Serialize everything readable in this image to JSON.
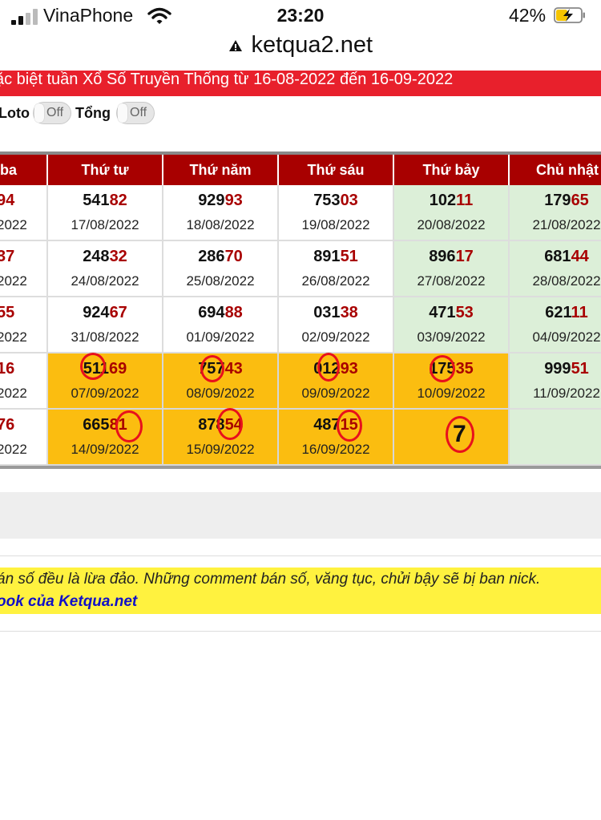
{
  "status_bar": {
    "carrier": "VinaPhone",
    "time": "23:20",
    "battery_percent": "42%",
    "url": "ketqua2.net"
  },
  "banner": {
    "text": "ặc biệt tuần Xổ Số Truyền Thống từ 16-08-2022 đến 16-09-2022"
  },
  "toggles": {
    "loto_label": "Loto",
    "loto_state": "Off",
    "tong_label": "Tổng",
    "tong_state": "Off"
  },
  "table": {
    "headers": [
      "ba",
      "Thứ tư",
      "Thứ năm",
      "Thứ sáu",
      "Thứ bảy",
      "Chủ nhật"
    ],
    "rows": [
      [
        {
          "head": "",
          "tail": "94",
          "date": "2022"
        },
        {
          "head": "541",
          "tail": "82",
          "date": "17/08/2022"
        },
        {
          "head": "929",
          "tail": "93",
          "date": "18/08/2022"
        },
        {
          "head": "753",
          "tail": "03",
          "date": "19/08/2022"
        },
        {
          "head": "102",
          "tail": "11",
          "date": "20/08/2022"
        },
        {
          "head": "179",
          "tail": "65",
          "date": "21/08/2022"
        }
      ],
      [
        {
          "head": "",
          "tail": "37",
          "date": "2022"
        },
        {
          "head": "248",
          "tail": "32",
          "date": "24/08/2022"
        },
        {
          "head": "286",
          "tail": "70",
          "date": "25/08/2022"
        },
        {
          "head": "891",
          "tail": "51",
          "date": "26/08/2022"
        },
        {
          "head": "896",
          "tail": "17",
          "date": "27/08/2022"
        },
        {
          "head": "681",
          "tail": "44",
          "date": "28/08/2022"
        }
      ],
      [
        {
          "head": "",
          "tail": "55",
          "date": "2022"
        },
        {
          "head": "924",
          "tail": "67",
          "date": "31/08/2022"
        },
        {
          "head": "694",
          "tail": "88",
          "date": "01/09/2022"
        },
        {
          "head": "031",
          "tail": "38",
          "date": "02/09/2022"
        },
        {
          "head": "471",
          "tail": "53",
          "date": "03/09/2022"
        },
        {
          "head": "621",
          "tail": "11",
          "date": "04/09/2022"
        }
      ],
      [
        {
          "head": "",
          "tail": "16",
          "date": "2022"
        },
        {
          "head": "511",
          "tail": "69",
          "date": "07/09/2022"
        },
        {
          "head": "757",
          "tail": "43",
          "date": "08/09/2022"
        },
        {
          "head": "012",
          "tail": "93",
          "date": "09/09/2022"
        },
        {
          "head": "175",
          "tail": "35",
          "date": "10/09/2022"
        },
        {
          "head": "999",
          "tail": "51",
          "date": "11/09/2022"
        }
      ],
      [
        {
          "head": "",
          "tail": "76",
          "date": "2022"
        },
        {
          "head": "665",
          "tail": "81",
          "date": "14/09/2022"
        },
        {
          "head": "878",
          "tail": "54",
          "date": "15/09/2022"
        },
        {
          "head": "487",
          "tail": "15",
          "date": "16/09/2022"
        },
        {
          "head": "",
          "tail": "",
          "date": ""
        },
        {
          "head": "",
          "tail": "",
          "date": ""
        }
      ]
    ],
    "handwritten_mark": "7",
    "colors": {
      "header_bg": "#a80000",
      "highlight_digits": "#a80000",
      "weekend_bg": "#dcefd8",
      "marked_bg": "#fbbd10",
      "annotation": "#e8101c"
    }
  },
  "notice": {
    "line1": "án số đều là lừa đảo. Những comment bán số, văng tục, chửi bậy sẽ bị ban nick.",
    "line2": "ook của Ketqua.net"
  }
}
